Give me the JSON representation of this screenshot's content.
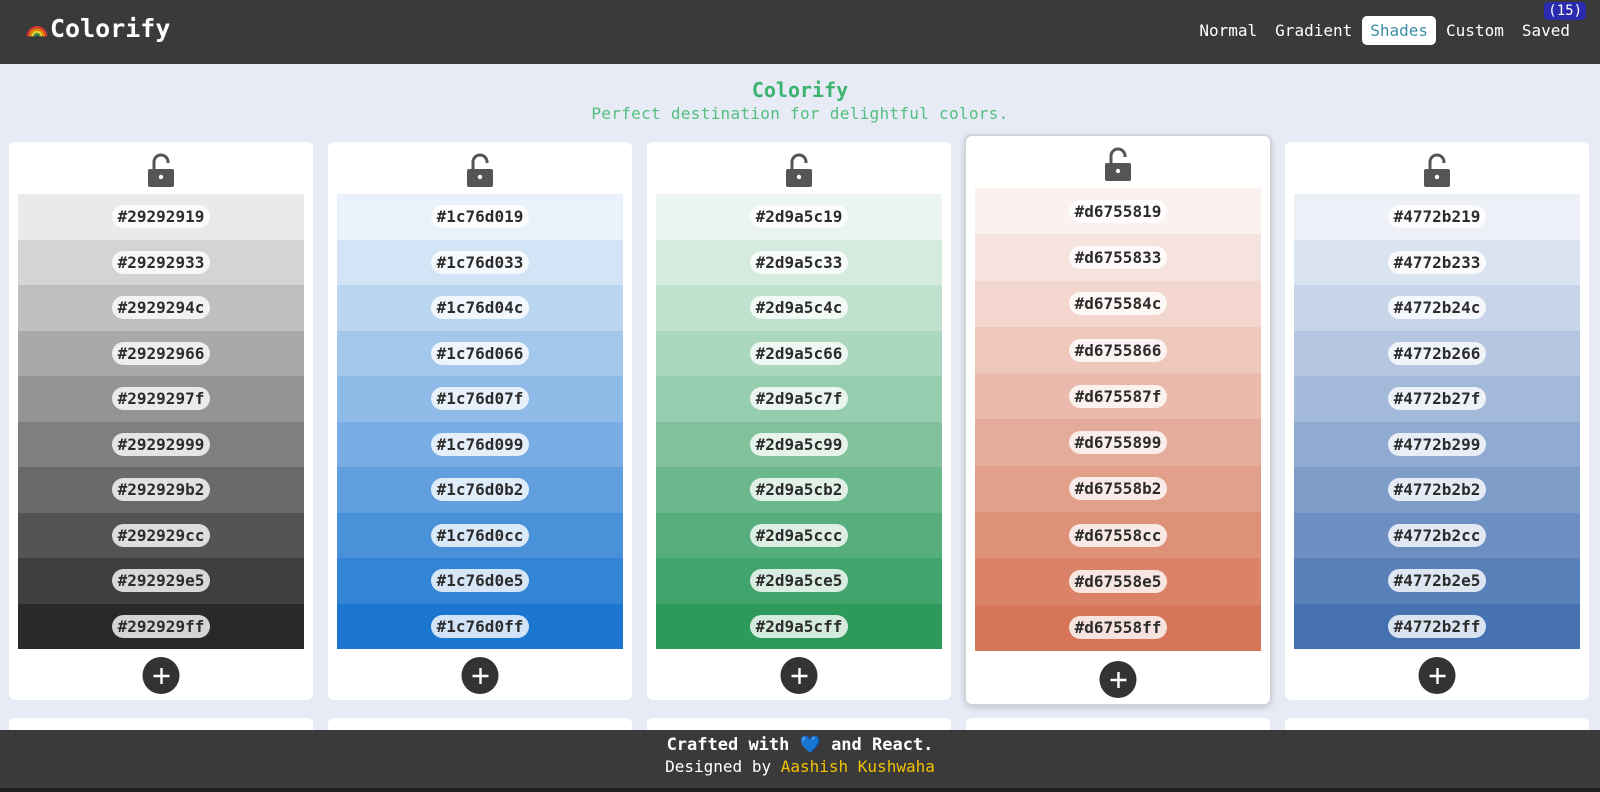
{
  "header": {
    "app_name": "Colorify",
    "nav": [
      {
        "label": "Normal"
      },
      {
        "label": "Gradient"
      },
      {
        "label": "Shades"
      },
      {
        "label": "Custom"
      },
      {
        "label": "Saved"
      }
    ],
    "saved_count": "(15)",
    "active_tab": "Shades"
  },
  "hero": {
    "title": "Colorify",
    "subtitle": "Perfect destination for delightful colors."
  },
  "palettes": [
    {
      "base": "#292929",
      "locked": false,
      "shades": [
        "#29292919",
        "#29292933",
        "#2929294c",
        "#29292966",
        "#2929297f",
        "#29292999",
        "#292929b2",
        "#292929cc",
        "#292929e5",
        "#292929ff"
      ]
    },
    {
      "base": "#1c76d0",
      "locked": false,
      "shades": [
        "#1c76d019",
        "#1c76d033",
        "#1c76d04c",
        "#1c76d066",
        "#1c76d07f",
        "#1c76d099",
        "#1c76d0b2",
        "#1c76d0cc",
        "#1c76d0e5",
        "#1c76d0ff"
      ]
    },
    {
      "base": "#2d9a5c",
      "locked": false,
      "shades": [
        "#2d9a5c19",
        "#2d9a5c33",
        "#2d9a5c4c",
        "#2d9a5c66",
        "#2d9a5c7f",
        "#2d9a5c99",
        "#2d9a5cb2",
        "#2d9a5ccc",
        "#2d9a5ce5",
        "#2d9a5cff"
      ]
    },
    {
      "base": "#d67558",
      "locked": false,
      "selected": true,
      "shades": [
        "#d6755819",
        "#d6755833",
        "#d675584c",
        "#d6755866",
        "#d675587f",
        "#d6755899",
        "#d67558b2",
        "#d67558cc",
        "#d67558e5",
        "#d67558ff"
      ]
    },
    {
      "base": "#4772b2",
      "locked": false,
      "shades": [
        "#4772b219",
        "#4772b233",
        "#4772b24c",
        "#4772b266",
        "#4772b27f",
        "#4772b299",
        "#4772b2b2",
        "#4772b2cc",
        "#4772b2e5",
        "#4772b2ff"
      ]
    }
  ],
  "footer": {
    "line1_before": "Crafted with",
    "heart": "💙",
    "line1_after": "and React.",
    "line2_before": "Designed by",
    "author": "Aashish Kushwaha"
  },
  "colors": {
    "header_bg": "#3a3a3a",
    "page_bg": "#e6ebf5",
    "active_tab_text": "#3b8ea5",
    "hero_text": "#3cb371",
    "author_link": "#f2c200",
    "badge_bg": "#2b2bb0"
  }
}
